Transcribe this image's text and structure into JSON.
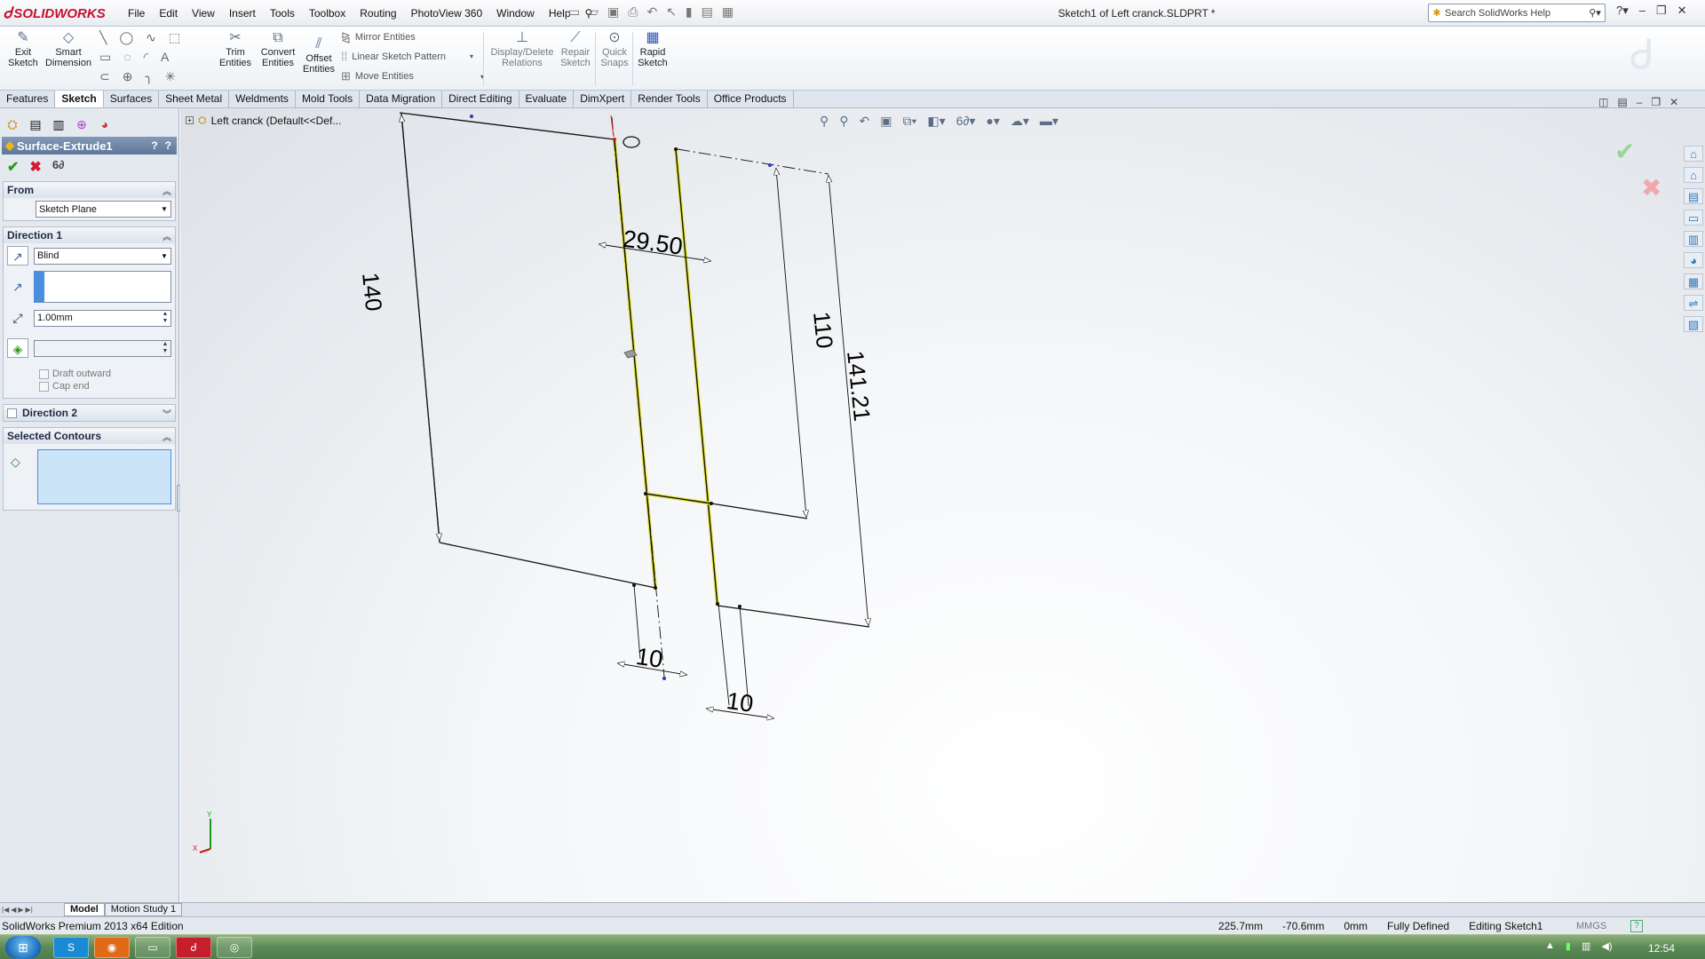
{
  "app": {
    "logo_text": "SOLIDWORKS",
    "document_title": "Sketch1 of Left cranck.SLDPRT *",
    "menu": [
      "File",
      "Edit",
      "View",
      "Insert",
      "Tools",
      "Toolbox",
      "Routing",
      "PhotoView 360",
      "Window",
      "Help"
    ],
    "help_search_placeholder": "Search SolidWorks Help"
  },
  "command_manager": {
    "exit_sketch": "Exit\nSketch",
    "exit_sketch_l1": "Exit",
    "exit_sketch_l2": "Sketch",
    "smart_dim_l1": "Smart",
    "smart_dim_l2": "Dimension",
    "trim_l1": "Trim",
    "trim_l2": "Entities",
    "convert_l1": "Convert",
    "convert_l2": "Entities",
    "offset_l1": "Offset",
    "offset_l2": "Entities",
    "mirror": "Mirror Entities",
    "linear_pattern": "Linear Sketch Pattern",
    "move": "Move Entities",
    "display_relations_l1": "Display/Delete",
    "display_relations_l2": "Relations",
    "repair_l1": "Repair",
    "repair_l2": "Sketch",
    "quick_snaps_l1": "Quick",
    "quick_snaps_l2": "Snaps",
    "rapid_l1": "Rapid",
    "rapid_l2": "Sketch"
  },
  "tabs": [
    "Features",
    "Sketch",
    "Surfaces",
    "Sheet Metal",
    "Weldments",
    "Mold Tools",
    "Data Migration",
    "Direct Editing",
    "Evaluate",
    "DimXpert",
    "Render Tools",
    "Office Products"
  ],
  "active_tab": "Sketch",
  "property_manager": {
    "title": "Surface-Extrude1",
    "from": {
      "header": "From",
      "value": "Sketch Plane"
    },
    "direction1": {
      "header": "Direction 1",
      "end_condition": "Blind",
      "depth": "1.00mm",
      "draft_outward": "Draft outward",
      "cap_end": "Cap end"
    },
    "direction2": {
      "header": "Direction 2"
    },
    "selected_contours": {
      "header": "Selected Contours"
    }
  },
  "graphics": {
    "tree_item": "Left cranck  (Default<<Def...",
    "dimensions": [
      "140",
      "29.50",
      "110",
      "141.21",
      "10",
      "10"
    ]
  },
  "bottom_tabs": [
    "Model",
    "Motion Study 1"
  ],
  "status": {
    "edition": "SolidWorks Premium 2013 x64 Edition",
    "x": "225.7mm",
    "y": "-70.6mm",
    "z": "0mm",
    "state": "Fully Defined",
    "mode": "Editing Sketch1",
    "units": "MMGS"
  },
  "taskbar": {
    "clock": "12:54"
  },
  "colors": {
    "accent": "#5e7799",
    "ok": "#2f9a1e",
    "cancel": "#d4192c",
    "sketch_line": "#111111",
    "highlight": "#e8e84a"
  }
}
